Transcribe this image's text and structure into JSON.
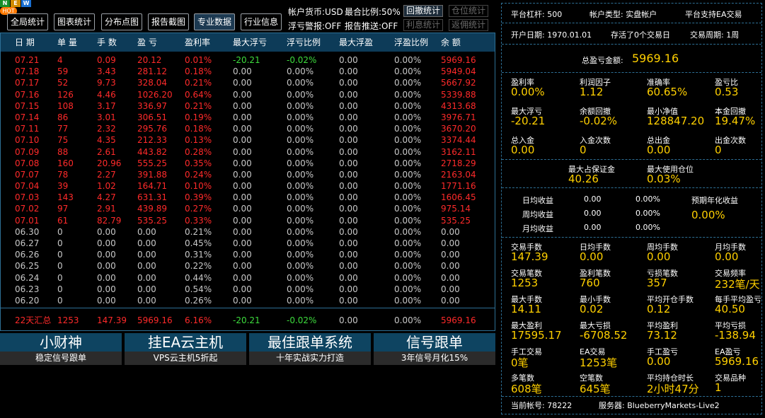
{
  "toolbar": {
    "buttons": [
      "全局统计",
      "图表统计",
      "分布点图",
      "报告截图",
      "专业数据",
      "行业信息"
    ],
    "new_badge": [
      "N",
      "E",
      "W"
    ],
    "hot_badge": "HOT",
    "currency": "帐户货币:USD",
    "max_ratio": "最合比例:50%",
    "float_warn": "浮亏警报:OFF",
    "report_push": "报告推送:OFF",
    "small_buttons": [
      "回撤统计",
      "仓位统计",
      "利息统计",
      "返佣统计"
    ]
  },
  "table": {
    "headers": [
      "日 期",
      "单 量",
      "手 数",
      "盈 亏",
      "盈利率",
      "最大浮亏",
      "浮亏比例",
      "最大浮盈",
      "浮盈比例",
      "余 额"
    ],
    "rows": [
      [
        "07.21",
        "4",
        "0.09",
        "20.12",
        "0.01%",
        "-20.21",
        "-0.02%",
        "0.00",
        "0.00%",
        "5969.16"
      ],
      [
        "07.18",
        "59",
        "3.43",
        "281.12",
        "0.18%",
        "0.00",
        "0.00%",
        "0.00",
        "0.00%",
        "5949.04"
      ],
      [
        "07.17",
        "52",
        "9.73",
        "328.04",
        "0.21%",
        "0.00",
        "0.00%",
        "0.00",
        "0.00%",
        "5667.92"
      ],
      [
        "07.16",
        "126",
        "4.46",
        "1026.20",
        "0.64%",
        "0.00",
        "0.00%",
        "0.00",
        "0.00%",
        "5339.88"
      ],
      [
        "07.15",
        "108",
        "3.17",
        "336.97",
        "0.21%",
        "0.00",
        "0.00%",
        "0.00",
        "0.00%",
        "4313.68"
      ],
      [
        "07.14",
        "86",
        "3.01",
        "306.51",
        "0.19%",
        "0.00",
        "0.00%",
        "0.00",
        "0.00%",
        "3976.71"
      ],
      [
        "07.11",
        "77",
        "2.32",
        "295.76",
        "0.18%",
        "0.00",
        "0.00%",
        "0.00",
        "0.00%",
        "3670.20"
      ],
      [
        "07.10",
        "75",
        "4.35",
        "212.33",
        "0.13%",
        "0.00",
        "0.00%",
        "0.00",
        "0.00%",
        "3374.44"
      ],
      [
        "07.09",
        "88",
        "2.61",
        "443.82",
        "0.28%",
        "0.00",
        "0.00%",
        "0.00",
        "0.00%",
        "3162.11"
      ],
      [
        "07.08",
        "160",
        "20.96",
        "555.25",
        "0.35%",
        "0.00",
        "0.00%",
        "0.00",
        "0.00%",
        "2718.29"
      ],
      [
        "07.07",
        "78",
        "2.27",
        "391.88",
        "0.24%",
        "0.00",
        "0.00%",
        "0.00",
        "0.00%",
        "2163.04"
      ],
      [
        "07.04",
        "39",
        "1.02",
        "164.71",
        "0.10%",
        "0.00",
        "0.00%",
        "0.00",
        "0.00%",
        "1771.16"
      ],
      [
        "07.03",
        "143",
        "4.27",
        "631.31",
        "0.39%",
        "0.00",
        "0.00%",
        "0.00",
        "0.00%",
        "1606.45"
      ],
      [
        "07.02",
        "97",
        "2.91",
        "439.89",
        "0.27%",
        "0.00",
        "0.00%",
        "0.00",
        "0.00%",
        "975.14"
      ],
      [
        "07.01",
        "61",
        "82.79",
        "535.25",
        "0.33%",
        "0.00",
        "0.00%",
        "0.00",
        "0.00%",
        "535.25"
      ],
      [
        "06.30",
        "0",
        "0.00",
        "0.00",
        "0.21%",
        "0.00",
        "0.00%",
        "0.00",
        "0.00%",
        "0.00"
      ],
      [
        "06.27",
        "0",
        "0.00",
        "0.00",
        "0.45%",
        "0.00",
        "0.00%",
        "0.00",
        "0.00%",
        "0.00"
      ],
      [
        "06.26",
        "0",
        "0.00",
        "0.00",
        "0.31%",
        "0.00",
        "0.00%",
        "0.00",
        "0.00%",
        "0.00"
      ],
      [
        "06.25",
        "0",
        "0.00",
        "0.00",
        "0.22%",
        "0.00",
        "0.00%",
        "0.00",
        "0.00%",
        "0.00"
      ],
      [
        "06.24",
        "0",
        "0.00",
        "0.00",
        "0.44%",
        "0.00",
        "0.00%",
        "0.00",
        "0.00%",
        "0.00"
      ],
      [
        "06.23",
        "0",
        "0.00",
        "0.00",
        "0.54%",
        "0.00",
        "0.00%",
        "0.00",
        "0.00%",
        "0.00"
      ],
      [
        "06.20",
        "0",
        "0.00",
        "0.00",
        "0.26%",
        "0.00",
        "0.00%",
        "0.00",
        "0.00%",
        "0.00"
      ]
    ],
    "summary": [
      "22天汇总",
      "1253",
      "147.39",
      "5969.16",
      "6.16%",
      "-20.21",
      "-0.02%",
      "0.00",
      "0.00%",
      "5969.16"
    ]
  },
  "ads": [
    {
      "title": "小财神",
      "sub": "稳定信号跟单"
    },
    {
      "title": "挂EA云主机",
      "sub": "VPS云主机5折起"
    },
    {
      "title": "最佳跟单系统",
      "sub": "十年实战实力打造"
    },
    {
      "title": "信号跟单",
      "sub": "3年信号月化15%"
    }
  ],
  "right": {
    "leverage": "平台杠杆:   500",
    "account_type": "帐户类型:   实盘帐户",
    "ea_support": "平台支持EA交易",
    "open_date": "开户日期:   1970.01.01",
    "survived": "存活了0个交易日",
    "cycle": "交易周期:   1周",
    "total_profit_label": "总盈亏金额:",
    "total_profit_value": "5969.16",
    "grid1": [
      {
        "label": "盈利率",
        "value": "0.00%"
      },
      {
        "label": "利润因子",
        "value": "1.12"
      },
      {
        "label": "准确率",
        "value": "60.65%"
      },
      {
        "label": "盈亏比",
        "value": "0.53"
      },
      {
        "label": "最大浮亏",
        "value": "-20.21"
      },
      {
        "label": "余额回撤",
        "value": "-0.02%"
      },
      {
        "label": "最小净值",
        "value": "128847.20"
      },
      {
        "label": "本金回撤",
        "value": "19.47%"
      },
      {
        "label": "总入金",
        "value": "0.00"
      },
      {
        "label": "入金次数",
        "value": "0"
      },
      {
        "label": "总出金",
        "value": "0.00"
      },
      {
        "label": "出金次数",
        "value": "0"
      }
    ],
    "margin": [
      {
        "label": "最大占保证金",
        "value": "40.26"
      },
      {
        "label": "最大使用仓位",
        "value": "0.03%"
      }
    ],
    "period": {
      "rows": [
        {
          "label": "日均收益",
          "a": "0.00",
          "b": "0.00%"
        },
        {
          "label": "周均收益",
          "a": "0.00",
          "b": "0.00%"
        },
        {
          "label": "月均收益",
          "a": "0.00",
          "b": "0.00%"
        }
      ],
      "annual_label": "预期年化收益",
      "annual_value": "0.00%"
    },
    "grid2": [
      {
        "label": "交易手数",
        "value": "147.39"
      },
      {
        "label": "日均手数",
        "value": "0.00"
      },
      {
        "label": "周均手数",
        "value": "0.00"
      },
      {
        "label": "月均手数",
        "value": "0.00"
      },
      {
        "label": "交易笔数",
        "value": "1253"
      },
      {
        "label": "盈利笔数",
        "value": "760"
      },
      {
        "label": "亏损笔数",
        "value": "357"
      },
      {
        "label": "交易频率",
        "value": "232笔/天"
      },
      {
        "label": "最大手数",
        "value": "14.11"
      },
      {
        "label": "最小手数",
        "value": "0.02"
      },
      {
        "label": "平均开仓手数",
        "value": "0.12"
      },
      {
        "label": "每手平均盈亏",
        "value": "40.50"
      },
      {
        "label": "最大盈利",
        "value": "17595.17"
      },
      {
        "label": "最大亏损",
        "value": "-6708.52"
      },
      {
        "label": "平均盈利",
        "value": "73.12"
      },
      {
        "label": "平均亏损",
        "value": "-138.94"
      },
      {
        "label": "手工交易",
        "value": "0笔"
      },
      {
        "label": "EA交易",
        "value": "1253笔"
      },
      {
        "label": "手工盈亏",
        "value": "0.00"
      },
      {
        "label": "EA盈亏",
        "value": "5969.16"
      },
      {
        "label": "多笔数",
        "value": "608笔"
      },
      {
        "label": "空笔数",
        "value": "645笔"
      },
      {
        "label": "平均持仓时长",
        "value": "2小时47分"
      },
      {
        "label": "交易品种",
        "value": "1"
      }
    ],
    "account": "当前帐号:   78222",
    "server": "服务器:   BlueberryMarkets-Live2"
  },
  "colors": {
    "profit": "#ff2a2a",
    "loss": "#3ddc3d",
    "value": "#ffd000",
    "header": "#0d3b58",
    "border": "#2d6f95"
  }
}
